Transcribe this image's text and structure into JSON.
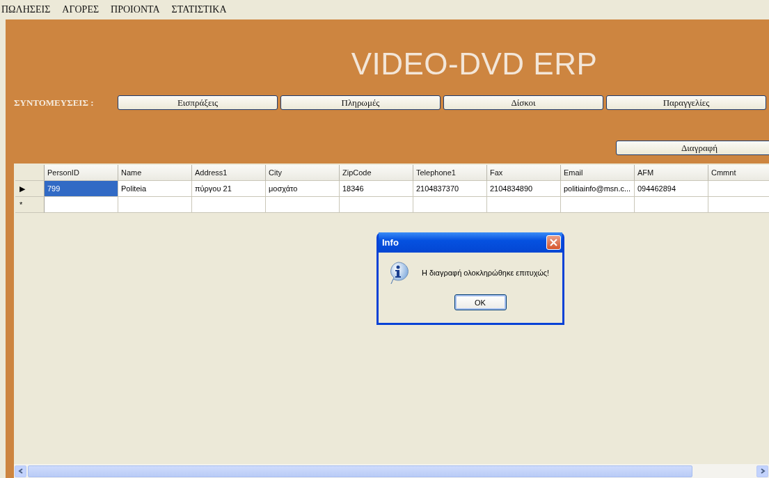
{
  "menu": [
    {
      "label": "ΠΩΛΗΣΕΙΣ"
    },
    {
      "label": "ΑΓΟΡΕΣ"
    },
    {
      "label": "ΠΡΟΙΟΝΤΑ"
    },
    {
      "label": "ΣΤΑΤΙΣΤΙΚΑ"
    }
  ],
  "header": {
    "title": "VIDEO-DVD ERP",
    "shortcuts_label": "ΣΥΝΤΟΜΕΥΣΕΙΣ :",
    "shortcuts": [
      "Εισπράξεις",
      "Πληρωμές",
      "Δίσκοι",
      "Παραγγελίες"
    ],
    "delete_button": "Διαγραφή"
  },
  "table": {
    "columns": [
      "PersonID",
      "Name",
      "Address1",
      "City",
      "ZipCode",
      "Telephone1",
      "Fax",
      "Email",
      "AFM",
      "Cmmnt"
    ],
    "rows": [
      {
        "marker": "▶",
        "cells": [
          {
            "text": "799",
            "selected": true
          },
          {
            "text": "Politeia",
            "selected": false
          },
          {
            "text": "πύργου 21",
            "selected": false
          },
          {
            "text": "μοσχάτο",
            "selected": false
          },
          {
            "text": "18346",
            "selected": false
          },
          {
            "text": "2104837370",
            "selected": false
          },
          {
            "text": "2104834890",
            "selected": false
          },
          {
            "text": "politiainfo@msn.c...",
            "selected": false
          },
          {
            "text": "094462894",
            "selected": false
          },
          {
            "selected": false
          }
        ]
      },
      {
        "marker": "*",
        "cells": [
          {
            "selected": false
          },
          {
            "selected": false
          },
          {
            "selected": false
          },
          {
            "selected": false
          },
          {
            "selected": false
          },
          {
            "selected": false
          },
          {
            "selected": false
          },
          {
            "selected": false
          },
          {
            "selected": false
          },
          {
            "selected": false
          }
        ]
      }
    ]
  },
  "dialog": {
    "title": "Info",
    "message": "Η διαγραφή ολοκληρώθηκε επιτυχώς!",
    "button": "OK"
  }
}
